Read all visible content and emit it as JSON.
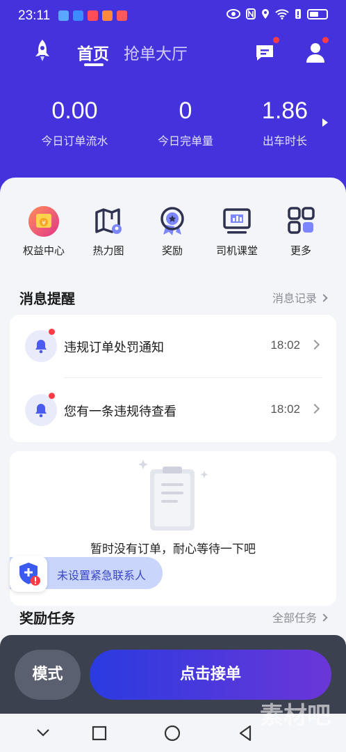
{
  "status_bar": {
    "time": "23:11"
  },
  "nav": {
    "tab_home": "首页",
    "tab_hall": "抢单大厅"
  },
  "stats": [
    {
      "value": "0.00",
      "label": "今日订单流水"
    },
    {
      "value": "0",
      "label": "今日完单量"
    },
    {
      "value": "1.86",
      "label": "出车时长"
    }
  ],
  "grid": [
    {
      "label": "权益中心",
      "icon": "rights-center-icon"
    },
    {
      "label": "热力图",
      "icon": "heatmap-icon"
    },
    {
      "label": "奖励",
      "icon": "reward-icon"
    },
    {
      "label": "司机课堂",
      "icon": "driver-class-icon"
    },
    {
      "label": "更多",
      "icon": "more-icon"
    }
  ],
  "messages": {
    "title": "消息提醒",
    "link": "消息记录",
    "items": [
      {
        "text": "违规订单处罚通知",
        "time": "18:02"
      },
      {
        "text": "您有一条违规待查看",
        "time": "18:02"
      }
    ]
  },
  "orders": {
    "empty_text": "暂时没有订单，耐心等待一下吧"
  },
  "emergency": {
    "text": "未设置紧急联系人"
  },
  "tasks": {
    "title": "奖励任务",
    "link": "全部任务"
  },
  "actions": {
    "mode": "模式",
    "take_order": "点击接单"
  },
  "watermark": "素材吧",
  "colors": {
    "brand": "#4433dd",
    "alert": "#ff3b46"
  }
}
